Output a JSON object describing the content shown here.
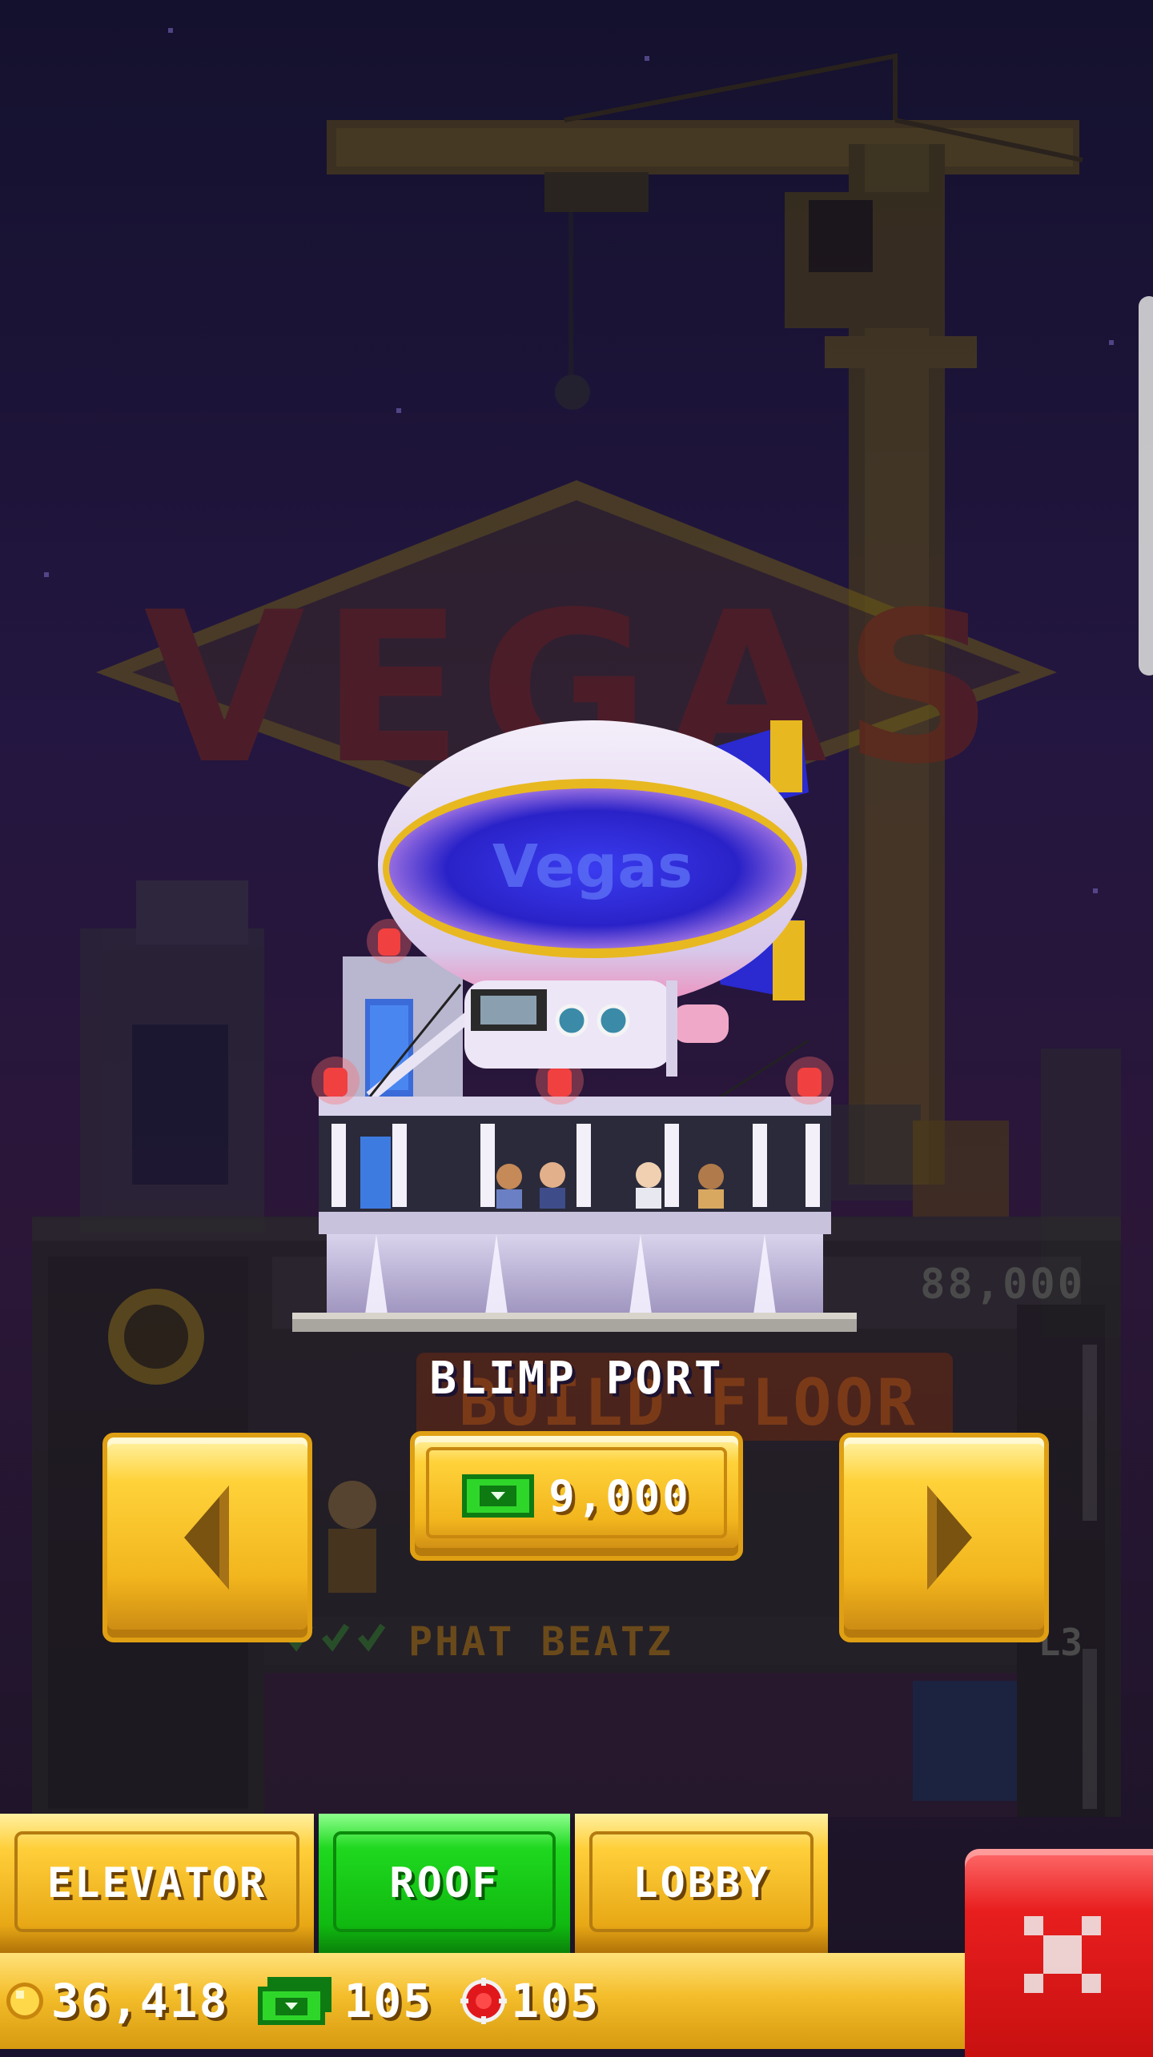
{
  "scene": {
    "background_sign": "VEGAS",
    "blimp_text": "Vegas",
    "floor_price": "88,000",
    "build_sign": "BUILD FLOOR",
    "floor_name": "PHAT BEATZ",
    "floor_level": "L3"
  },
  "roof": {
    "title": "BLIMP PORT",
    "cost": "9,000",
    "cost_currency_icon": "bux-icon"
  },
  "tabs": [
    {
      "label": "ELEVATOR",
      "selected": false
    },
    {
      "label": "ROOF",
      "selected": true
    },
    {
      "label": "LOBBY",
      "selected": false
    }
  ],
  "status": {
    "coins": "36,418",
    "bux": "105",
    "tickets": "105"
  },
  "colors": {
    "gold": "#f2b51d",
    "green": "#1fd81f",
    "red": "#e81e1e",
    "blimp_blue": "#2a2ad0"
  }
}
